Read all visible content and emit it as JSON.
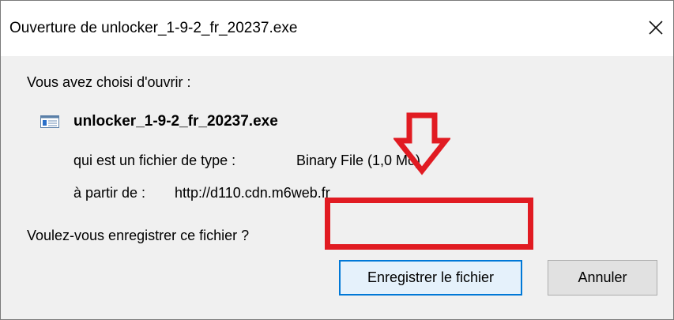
{
  "dialog": {
    "title": "Ouverture de unlocker_1-9-2_fr_20237.exe",
    "close_glyph": "✕",
    "intro": "Vous avez choisi d'ouvrir :",
    "file_icon": "executable-file-icon",
    "file_name": "unlocker_1-9-2_fr_20237.exe",
    "type_label": "qui est un fichier de type :",
    "type_value": "Binary File (1,0 Mo)",
    "from_label": "à partir de :",
    "from_value": "http://d110.cdn.m6web.fr",
    "question": "Voulez-vous enregistrer ce fichier ?",
    "save_label": "Enregistrer le fichier",
    "cancel_label": "Annuler"
  },
  "annotation": {
    "arrow_icon": "down-arrow-icon",
    "highlight_color": "#e11b22"
  },
  "colors": {
    "accent": "#0078d7",
    "dialog_bg": "#f0f0f0"
  }
}
